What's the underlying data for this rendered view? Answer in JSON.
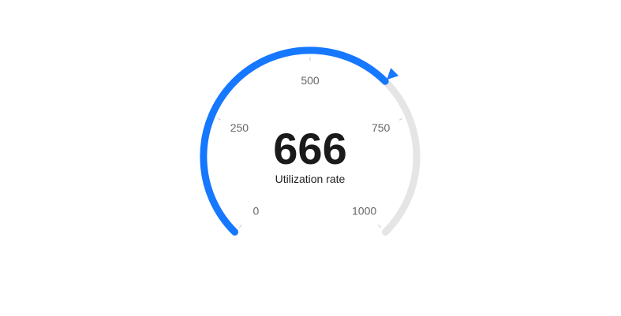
{
  "chart_data": {
    "type": "gauge",
    "value": 666,
    "min": 0,
    "max": 1000,
    "value_label": "666",
    "caption": "Utilization rate",
    "ticks": [
      {
        "value": 0,
        "label": "0"
      },
      {
        "value": 250,
        "label": "250"
      },
      {
        "value": 500,
        "label": "500"
      },
      {
        "value": 750,
        "label": "750"
      },
      {
        "value": 1000,
        "label": "1000"
      }
    ],
    "colors": {
      "progress": "#1677ff",
      "track": "#e5e5e5",
      "pointer": "#1677ff",
      "value_text": "#1a1a1a",
      "tick_text": "#666666"
    }
  }
}
